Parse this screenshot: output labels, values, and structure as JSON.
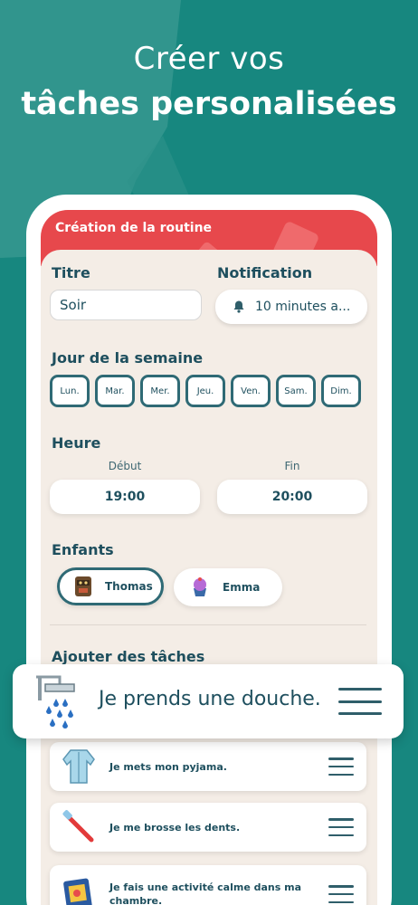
{
  "hero": {
    "line1": "Créer vos",
    "line2": "tâches personalisées"
  },
  "screen": {
    "header_title": "Création de la routine",
    "title_label": "Titre",
    "title_value": "Soir",
    "notification_label": "Notification",
    "notification_value": "10 minutes a...",
    "weekday_label": "Jour de la semaine",
    "days": [
      "Lun.",
      "Mar.",
      "Mer.",
      "Jeu.",
      "Ven.",
      "Sam.",
      "Dim."
    ],
    "time_label": "Heure",
    "start_label": "Début",
    "start_value": "19:00",
    "end_label": "Fin",
    "end_value": "20:00",
    "children_label": "Enfants",
    "children": [
      {
        "name": "Thomas",
        "selected": true
      },
      {
        "name": "Emma",
        "selected": false
      }
    ],
    "add_tasks_label": "Ajouter des tâches",
    "tasks": [
      {
        "text": "Je mets mon pyjama.",
        "icon": "pajamas-icon"
      },
      {
        "text": "Je me brosse les dents.",
        "icon": "toothbrush-icon"
      },
      {
        "text": "Je fais une activité calme dans ma chambre.",
        "icon": "book-icon"
      }
    ]
  },
  "floating_task": {
    "text": "Je prends une douche.",
    "icon": "shower-icon"
  },
  "colors": {
    "background": "#17877f",
    "header": "#e7484c",
    "text": "#1e4f5e",
    "content_bg": "#f4ede6"
  }
}
